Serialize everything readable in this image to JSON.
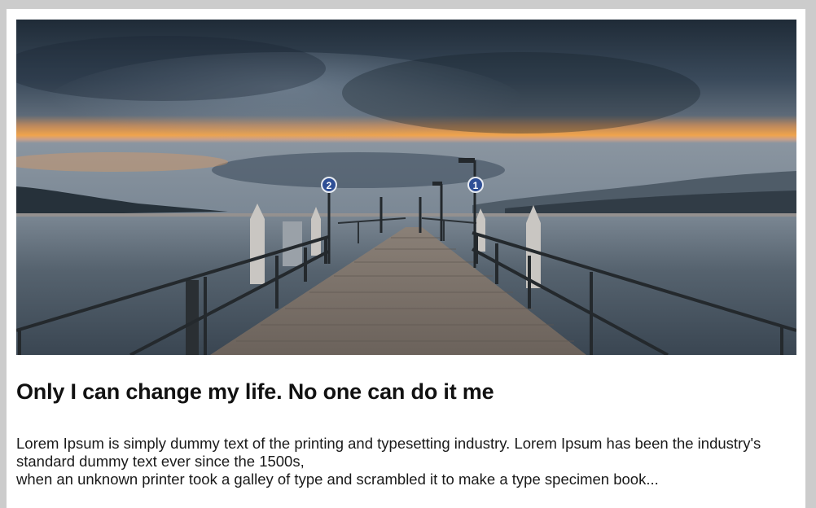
{
  "hero": {
    "image_name": "pier-over-lake-at-dusk",
    "sign_left": "2",
    "sign_right": "1",
    "colors": {
      "sky_dark": "#1e2a36",
      "sky_glow": "#f0a24a",
      "water": "#4d5a66",
      "deck": "#7a7068"
    }
  },
  "article": {
    "title": "Only I can change my life. No one can do it me",
    "text_line1": "Lorem Ipsum is simply dummy text of the printing and typesetting industry. Lorem Ipsum has been the industry's standard dummy text ever since the 1500s,",
    "text_line2": "when an unknown printer took a galley of type and scrambled it to make a type specimen book..."
  }
}
